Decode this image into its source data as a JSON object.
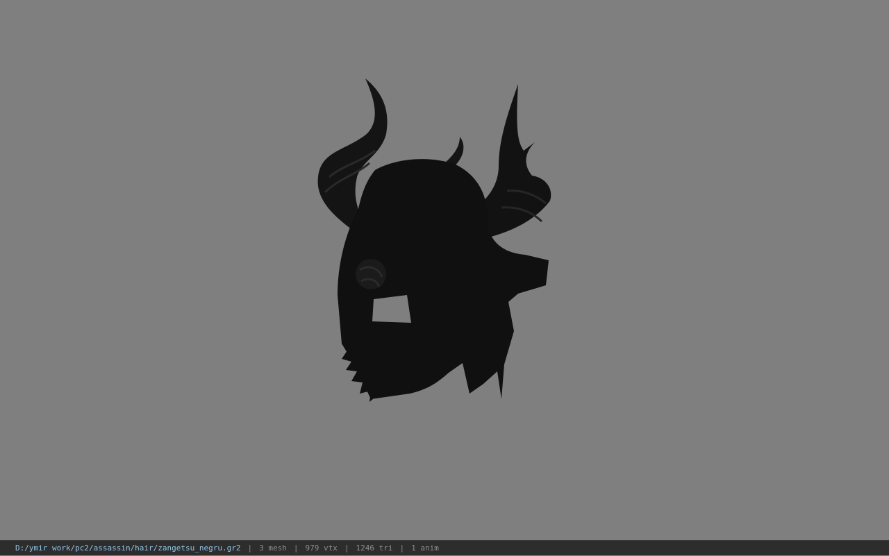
{
  "viewer": {
    "background_color": "#7f7f7f",
    "model_color": "#111111",
    "model_icon": "horned-helmet-silhouette"
  },
  "status": {
    "path": "D:/ymir work/pc2/assassin/hair/zangetsu_negru.gr2",
    "separator": "|",
    "mesh": "3 mesh",
    "vtx": "979 vtx",
    "tri": "1246 tri",
    "anim": "1 anim",
    "path_color": "#8fc6e8",
    "bar_color": "#2d2d2d"
  }
}
